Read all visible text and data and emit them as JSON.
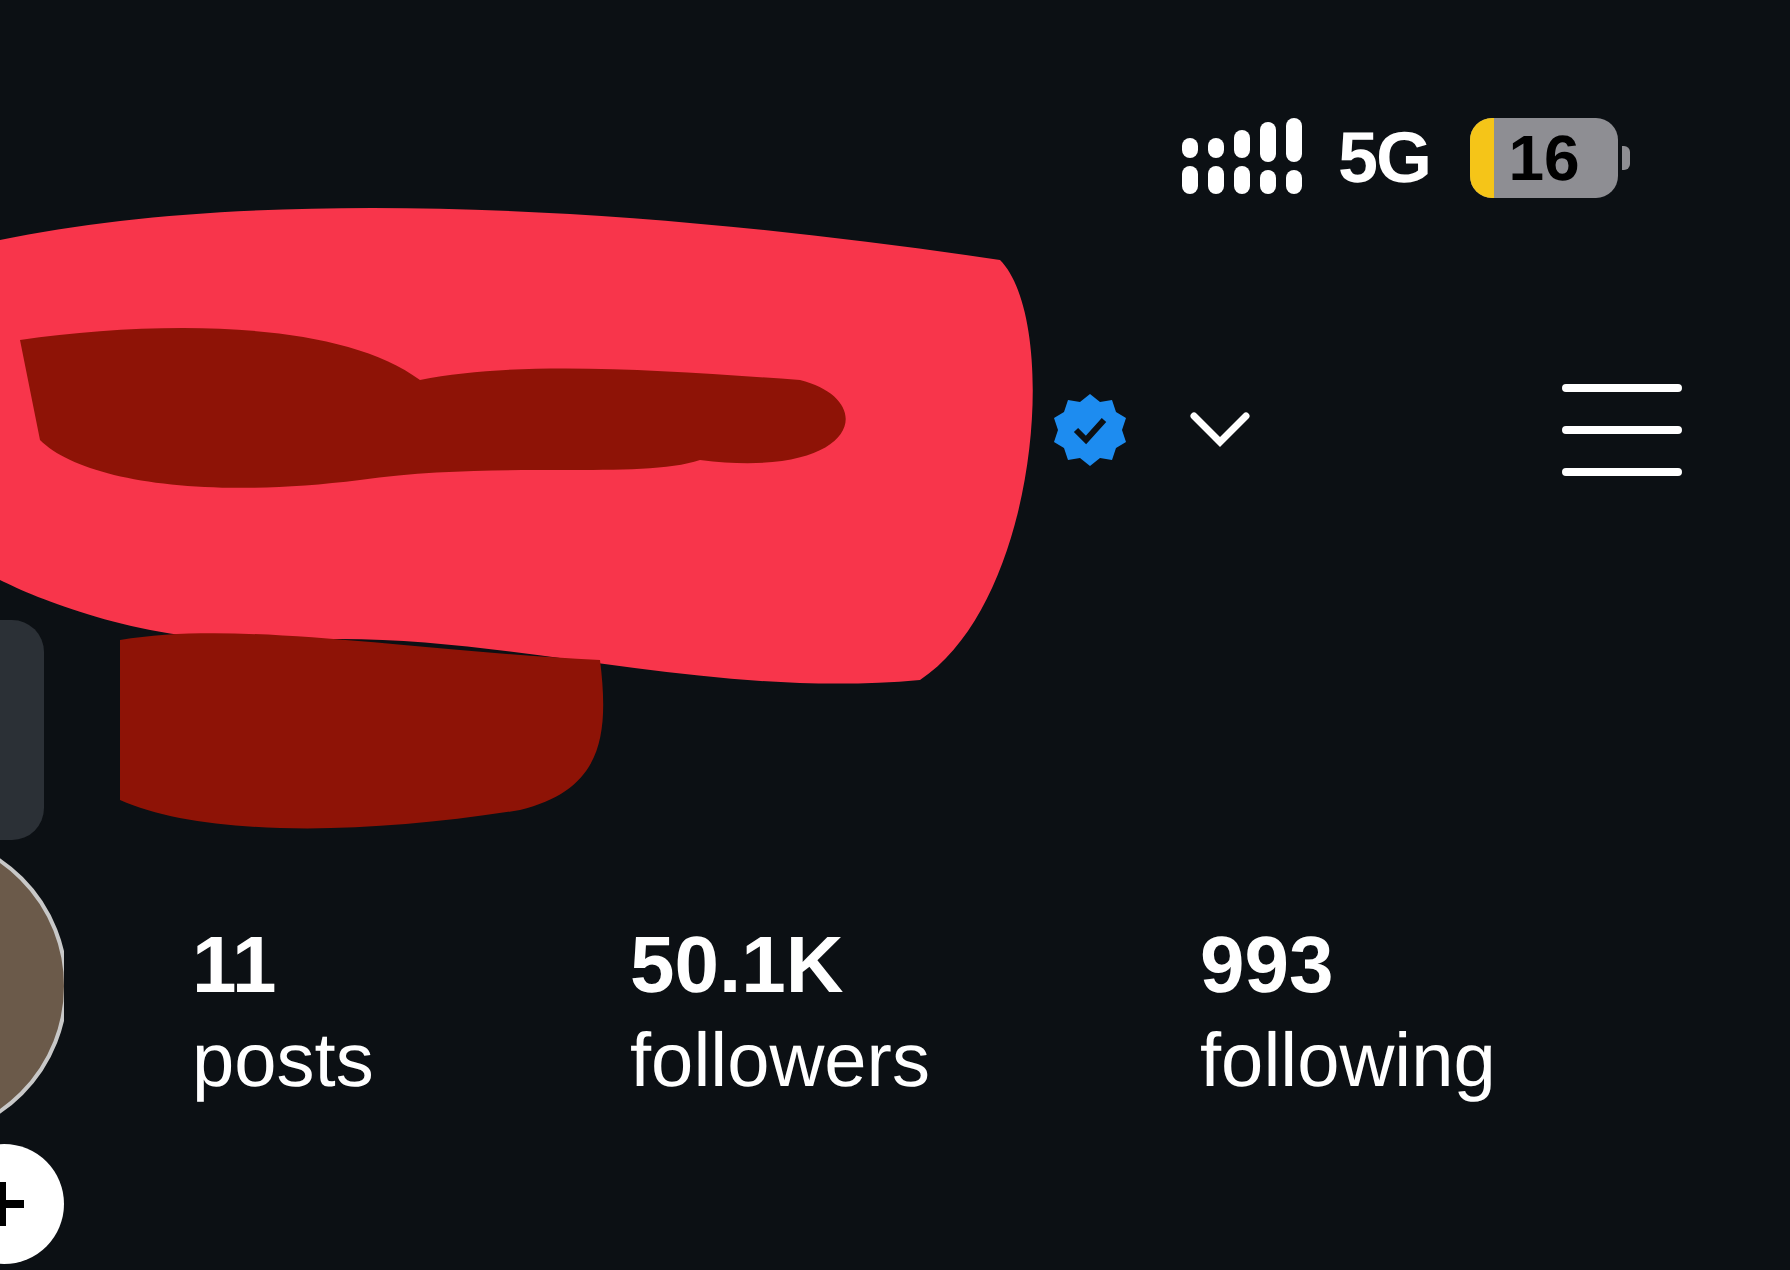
{
  "status_bar": {
    "network": "5G",
    "battery": "16"
  },
  "stats": [
    {
      "value": "11",
      "label": "posts"
    },
    {
      "value": "50.1K",
      "label": "followers"
    },
    {
      "value": "993",
      "label": "following"
    }
  ]
}
